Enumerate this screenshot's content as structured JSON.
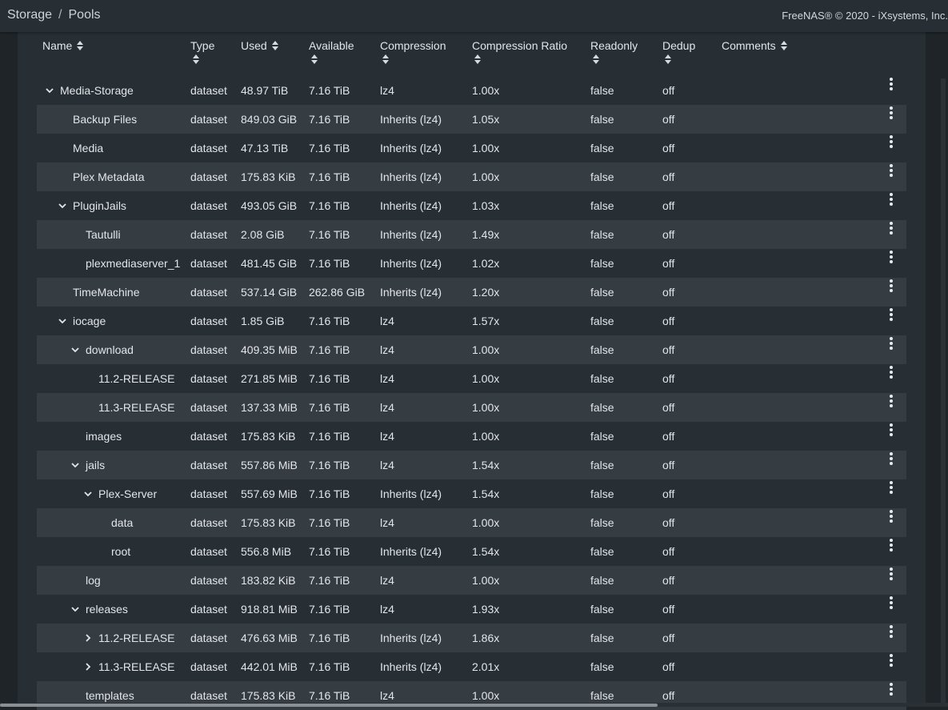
{
  "header": {
    "breadcrumb": [
      "Storage",
      "Pools"
    ],
    "copyright": "FreeNAS® © 2020 - iXsystems, Inc."
  },
  "table": {
    "columns": {
      "name": "Name",
      "type": "Type",
      "used": "Used",
      "available": "Available",
      "compression": "Compression",
      "compression_ratio": "Compression Ratio",
      "readonly": "Readonly",
      "dedup": "Dedup",
      "comments": "Comments"
    },
    "rows": [
      {
        "name": "Media-Storage",
        "level": 0,
        "toggle": "expanded",
        "type": "dataset",
        "used": "48.97 TiB",
        "available": "7.16 TiB",
        "compression": "lz4",
        "ratio": "1.00x",
        "readonly": "false",
        "dedup": "off",
        "comments": ""
      },
      {
        "name": "Backup Files",
        "level": 1,
        "toggle": "none",
        "type": "dataset",
        "used": "849.03 GiB",
        "available": "7.16 TiB",
        "compression": "Inherits (lz4)",
        "ratio": "1.05x",
        "readonly": "false",
        "dedup": "off",
        "comments": ""
      },
      {
        "name": "Media",
        "level": 1,
        "toggle": "none",
        "type": "dataset",
        "used": "47.13 TiB",
        "available": "7.16 TiB",
        "compression": "Inherits (lz4)",
        "ratio": "1.00x",
        "readonly": "false",
        "dedup": "off",
        "comments": ""
      },
      {
        "name": "Plex Metadata",
        "level": 1,
        "toggle": "none",
        "type": "dataset",
        "used": "175.83 KiB",
        "available": "7.16 TiB",
        "compression": "Inherits (lz4)",
        "ratio": "1.00x",
        "readonly": "false",
        "dedup": "off",
        "comments": ""
      },
      {
        "name": "PluginJails",
        "level": 1,
        "toggle": "expanded",
        "type": "dataset",
        "used": "493.05 GiB",
        "available": "7.16 TiB",
        "compression": "Inherits (lz4)",
        "ratio": "1.03x",
        "readonly": "false",
        "dedup": "off",
        "comments": ""
      },
      {
        "name": "Tautulli",
        "level": 2,
        "toggle": "none",
        "type": "dataset",
        "used": "2.08 GiB",
        "available": "7.16 TiB",
        "compression": "Inherits (lz4)",
        "ratio": "1.49x",
        "readonly": "false",
        "dedup": "off",
        "comments": ""
      },
      {
        "name": "plexmediaserver_1",
        "level": 2,
        "toggle": "none",
        "type": "dataset",
        "used": "481.45 GiB",
        "available": "7.16 TiB",
        "compression": "Inherits (lz4)",
        "ratio": "1.02x",
        "readonly": "false",
        "dedup": "off",
        "comments": ""
      },
      {
        "name": "TimeMachine",
        "level": 1,
        "toggle": "none",
        "type": "dataset",
        "used": "537.14 GiB",
        "available": "262.86 GiB",
        "compression": "Inherits (lz4)",
        "ratio": "1.20x",
        "readonly": "false",
        "dedup": "off",
        "comments": ""
      },
      {
        "name": "iocage",
        "level": 1,
        "toggle": "expanded",
        "type": "dataset",
        "used": "1.85 GiB",
        "available": "7.16 TiB",
        "compression": "lz4",
        "ratio": "1.57x",
        "readonly": "false",
        "dedup": "off",
        "comments": ""
      },
      {
        "name": "download",
        "level": 2,
        "toggle": "expanded",
        "type": "dataset",
        "used": "409.35 MiB",
        "available": "7.16 TiB",
        "compression": "lz4",
        "ratio": "1.00x",
        "readonly": "false",
        "dedup": "off",
        "comments": ""
      },
      {
        "name": "11.2-RELEASE",
        "level": 3,
        "toggle": "none",
        "type": "dataset",
        "used": "271.85 MiB",
        "available": "7.16 TiB",
        "compression": "lz4",
        "ratio": "1.00x",
        "readonly": "false",
        "dedup": "off",
        "comments": ""
      },
      {
        "name": "11.3-RELEASE",
        "level": 3,
        "toggle": "none",
        "type": "dataset",
        "used": "137.33 MiB",
        "available": "7.16 TiB",
        "compression": "lz4",
        "ratio": "1.00x",
        "readonly": "false",
        "dedup": "off",
        "comments": ""
      },
      {
        "name": "images",
        "level": 2,
        "toggle": "none",
        "type": "dataset",
        "used": "175.83 KiB",
        "available": "7.16 TiB",
        "compression": "lz4",
        "ratio": "1.00x",
        "readonly": "false",
        "dedup": "off",
        "comments": ""
      },
      {
        "name": "jails",
        "level": 2,
        "toggle": "expanded",
        "type": "dataset",
        "used": "557.86 MiB",
        "available": "7.16 TiB",
        "compression": "lz4",
        "ratio": "1.54x",
        "readonly": "false",
        "dedup": "off",
        "comments": ""
      },
      {
        "name": "Plex-Server",
        "level": 3,
        "toggle": "expanded",
        "type": "dataset",
        "used": "557.69 MiB",
        "available": "7.16 TiB",
        "compression": "Inherits (lz4)",
        "ratio": "1.54x",
        "readonly": "false",
        "dedup": "off",
        "comments": ""
      },
      {
        "name": "data",
        "level": 4,
        "toggle": "none",
        "type": "dataset",
        "used": "175.83 KiB",
        "available": "7.16 TiB",
        "compression": "lz4",
        "ratio": "1.00x",
        "readonly": "false",
        "dedup": "off",
        "comments": ""
      },
      {
        "name": "root",
        "level": 4,
        "toggle": "none",
        "type": "dataset",
        "used": "556.8 MiB",
        "available": "7.16 TiB",
        "compression": "Inherits (lz4)",
        "ratio": "1.54x",
        "readonly": "false",
        "dedup": "off",
        "comments": ""
      },
      {
        "name": "log",
        "level": 2,
        "toggle": "none",
        "type": "dataset",
        "used": "183.82 KiB",
        "available": "7.16 TiB",
        "compression": "lz4",
        "ratio": "1.00x",
        "readonly": "false",
        "dedup": "off",
        "comments": ""
      },
      {
        "name": "releases",
        "level": 2,
        "toggle": "expanded",
        "type": "dataset",
        "used": "918.81 MiB",
        "available": "7.16 TiB",
        "compression": "lz4",
        "ratio": "1.93x",
        "readonly": "false",
        "dedup": "off",
        "comments": ""
      },
      {
        "name": "11.2-RELEASE",
        "level": 3,
        "toggle": "collapsed",
        "type": "dataset",
        "used": "476.63 MiB",
        "available": "7.16 TiB",
        "compression": "Inherits (lz4)",
        "ratio": "1.86x",
        "readonly": "false",
        "dedup": "off",
        "comments": ""
      },
      {
        "name": "11.3-RELEASE",
        "level": 3,
        "toggle": "collapsed",
        "type": "dataset",
        "used": "442.01 MiB",
        "available": "7.16 TiB",
        "compression": "Inherits (lz4)",
        "ratio": "2.01x",
        "readonly": "false",
        "dedup": "off",
        "comments": ""
      },
      {
        "name": "templates",
        "level": 2,
        "toggle": "none",
        "type": "dataset",
        "used": "175.83 KiB",
        "available": "7.16 TiB",
        "compression": "lz4",
        "ratio": "1.00x",
        "readonly": "false",
        "dedup": "off",
        "comments": ""
      }
    ]
  },
  "icons": {
    "expanded": "chevron-down-icon",
    "collapsed": "chevron-right-icon",
    "row_menu": "more-vertical-icon",
    "sort": "sort-icon"
  },
  "colors": {
    "background": "#1f2428",
    "card": "#272e34",
    "row_alt": "#353c42",
    "text": "#e3e6e9"
  }
}
